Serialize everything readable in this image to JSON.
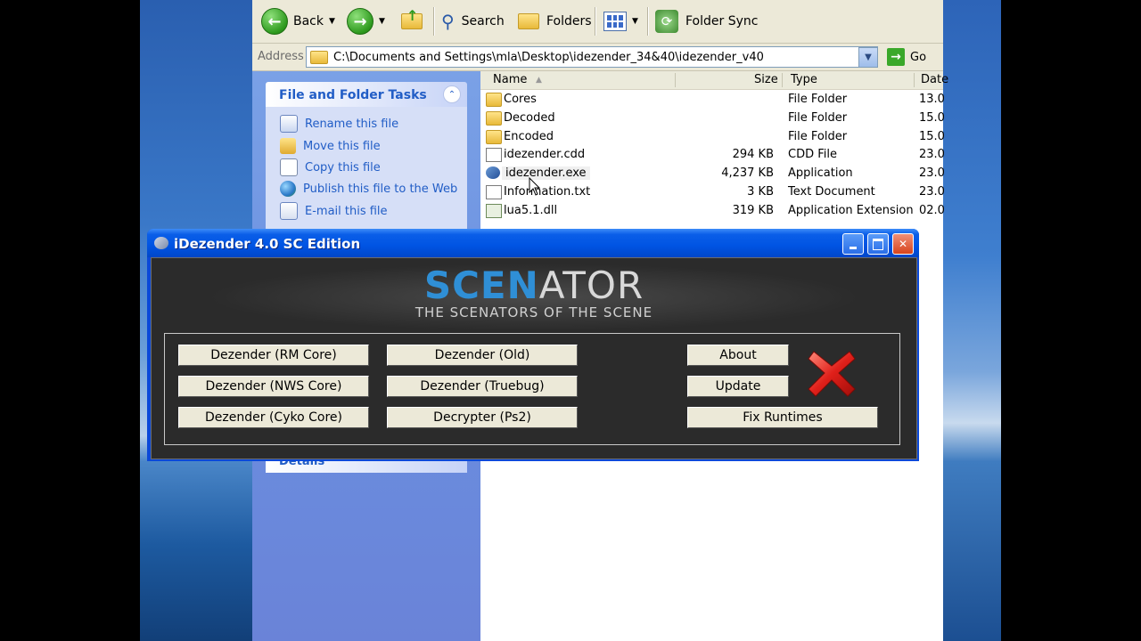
{
  "toolbar": {
    "back_label": "Back",
    "search_label": "Search",
    "folders_label": "Folders",
    "folder_sync_label": "Folder Sync"
  },
  "address": {
    "label": "Address",
    "path": "C:\\Documents and Settings\\mla\\Desktop\\idezender_34&40\\idezender_v40",
    "go_label": "Go"
  },
  "tasks": {
    "title": "File and Folder Tasks",
    "items": [
      {
        "label": "Rename this file",
        "icon": "rename-icon"
      },
      {
        "label": "Move this file",
        "icon": "move-icon"
      },
      {
        "label": "Copy this file",
        "icon": "copy-icon"
      },
      {
        "label": "Publish this file to the Web",
        "icon": "globe-icon"
      },
      {
        "label": "E-mail this file",
        "icon": "email-icon"
      }
    ],
    "details_title": "Details"
  },
  "filelist": {
    "columns": {
      "name": "Name",
      "size": "Size",
      "type": "Type",
      "date": "Date"
    },
    "rows": [
      {
        "name": "Cores",
        "size": "",
        "type": "File Folder",
        "date": "13.0",
        "icon": "folder"
      },
      {
        "name": "Decoded",
        "size": "",
        "type": "File Folder",
        "date": "15.0",
        "icon": "folder"
      },
      {
        "name": "Encoded",
        "size": "",
        "type": "File Folder",
        "date": "15.0",
        "icon": "folder"
      },
      {
        "name": "idezender.cdd",
        "size": "294 KB",
        "type": "CDD File",
        "date": "23.0",
        "icon": "file"
      },
      {
        "name": "idezender.exe",
        "size": "4,237 KB",
        "type": "Application",
        "date": "23.0",
        "icon": "exe"
      },
      {
        "name": "Information.txt",
        "size": "3 KB",
        "type": "Text Document",
        "date": "23.0",
        "icon": "file"
      },
      {
        "name": "lua5.1.dll",
        "size": "319 KB",
        "type": "Application Extension",
        "date": "02.0",
        "icon": "dll"
      }
    ]
  },
  "dialog": {
    "title": "iDezender 4.0 SC Edition",
    "logo_part1": "SCEN",
    "logo_part2": "ATOR",
    "tagline": "THE SCENATORS OF THE SCENE",
    "buttons": {
      "rm_core": "Dezender (RM Core)",
      "nws_core": "Dezender (NWS Core)",
      "cyko_core": "Dezender (Cyko Core)",
      "old": "Dezender (Old)",
      "truebug": "Dezender (Truebug)",
      "ps2": "Decrypter (Ps2)",
      "about": "About",
      "update": "Update",
      "fix_runtimes": "Fix Runtimes"
    }
  },
  "colors": {
    "xp_blue": "#0054e3",
    "logo_blue": "#2f8fd6",
    "task_link": "#215dc6",
    "close_red": "#d8441c"
  }
}
